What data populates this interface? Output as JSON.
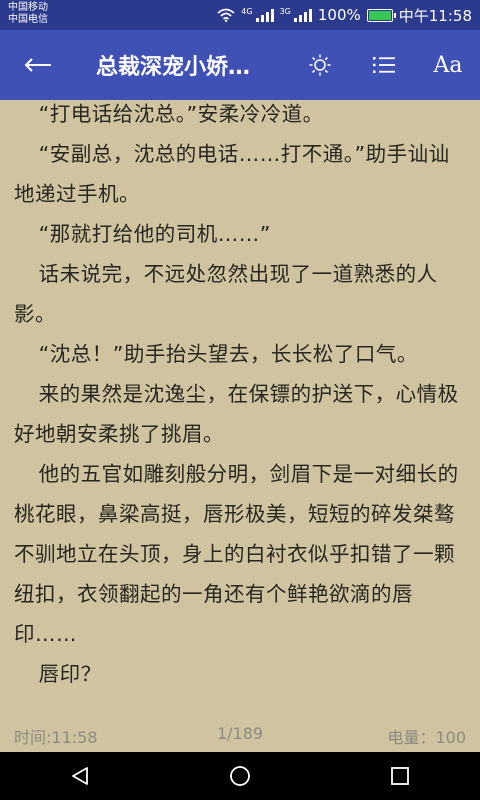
{
  "status_bar": {
    "carrier_1": "中国移动",
    "carrier_2": "中国电信",
    "network_1": "4G",
    "network_2": "3G",
    "battery_percent": "100%",
    "time": "中午11:58"
  },
  "toolbar": {
    "back_icon": "arrow-left-icon",
    "title": "总裁深宠小娇…",
    "brightness_icon": "sun-icon",
    "toc_icon": "list-icon",
    "font_label": "Aa"
  },
  "paragraphs": [
    "“打电话给沈总。”安柔冷冷道。",
    "“安副总，沈总的电话……打不通。”助手讪讪地递过手机。",
    "“那就打给他的司机……”",
    "话未说完，不远处忽然出现了一道熟悉的人影。",
    "“沈总！”助手抬头望去，长长松了口气。",
    "来的果然是沈逸尘，在保镖的护送下，心情极好地朝安柔挑了挑眉。",
    "他的五官如雕刻般分明，剑眉下是一对细长的桃花眼，鼻梁高挺，唇形极美，短短的碎发桀骜不驯地立在头顶，身上的白衬衣似乎扣错了一颗纽扣，衣领翻起的一角还有个鲜艳欲滴的唇印……",
    "唇印？"
  ],
  "footer": {
    "time": "时间:11:58",
    "page": "1/189",
    "battery": "电量：100"
  },
  "colors": {
    "status_bar": "#2B3A8C",
    "toolbar": "#3F51B5",
    "page_background": "#CFC3A0",
    "text": "#2A2620",
    "battery_green": "#35C74F"
  },
  "navbar": {
    "back_icon": "triangle-back-icon",
    "home_icon": "circle-home-icon",
    "recents_icon": "square-recents-icon"
  }
}
